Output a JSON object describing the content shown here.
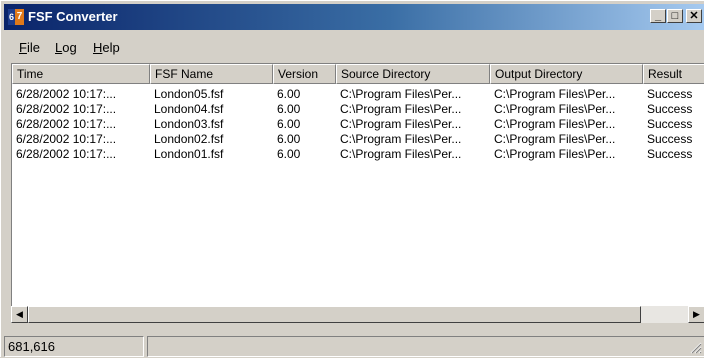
{
  "window": {
    "title": "FSF Converter",
    "icon": "fsf-converter-app-icon",
    "icon_digits": [
      "6",
      "7"
    ]
  },
  "titlebar_buttons": {
    "minimize": "_",
    "maximize": "□",
    "close": "✕"
  },
  "menu": [
    {
      "label": "File",
      "hotkey": "F",
      "rest": "ile"
    },
    {
      "label": "Log",
      "hotkey": "L",
      "rest": "og"
    },
    {
      "label": "Help",
      "hotkey": "H",
      "rest": "elp"
    }
  ],
  "table": {
    "columns": [
      "Time",
      "FSF Name",
      "Version",
      "Source Directory",
      "Output Directory",
      "Result"
    ],
    "rows": [
      [
        "6/28/2002 10:17:...",
        "London05.fsf",
        "6.00",
        "C:\\Program Files\\Per...",
        "C:\\Program Files\\Per...",
        "Success"
      ],
      [
        "6/28/2002 10:17:...",
        "London04.fsf",
        "6.00",
        "C:\\Program Files\\Per...",
        "C:\\Program Files\\Per...",
        "Success"
      ],
      [
        "6/28/2002 10:17:...",
        "London03.fsf",
        "6.00",
        "C:\\Program Files\\Per...",
        "C:\\Program Files\\Per...",
        "Success"
      ],
      [
        "6/28/2002 10:17:...",
        "London02.fsf",
        "6.00",
        "C:\\Program Files\\Per...",
        "C:\\Program Files\\Per...",
        "Success"
      ],
      [
        "6/28/2002 10:17:...",
        "London01.fsf",
        "6.00",
        "C:\\Program Files\\Per...",
        "C:\\Program Files\\Per...",
        "Success"
      ]
    ]
  },
  "scrollbar": {
    "left_icon": "scroll-left-arrow-icon",
    "right_icon": "scroll-right-arrow-icon",
    "left_glyph": "◀",
    "right_glyph": "▶"
  },
  "status": {
    "coords": "681,616",
    "pane2": ""
  }
}
